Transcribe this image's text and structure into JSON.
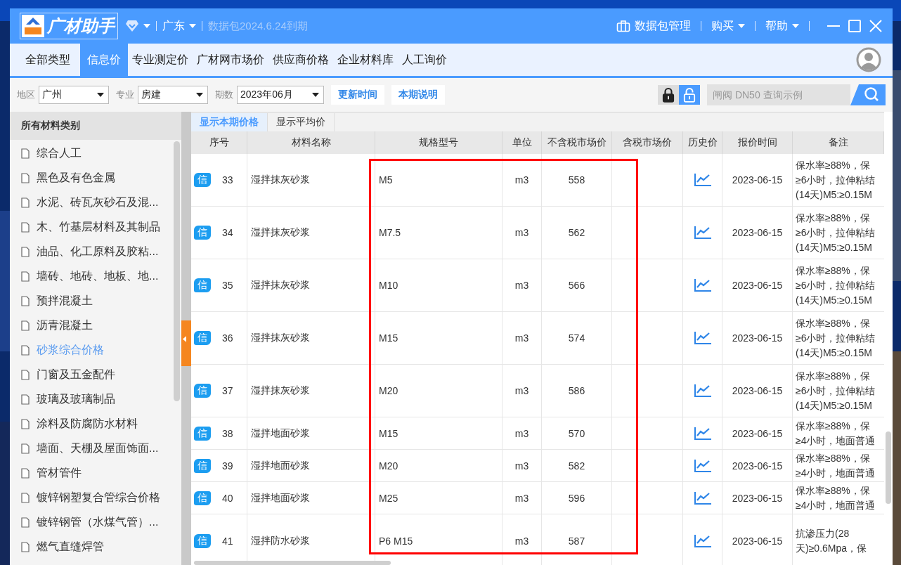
{
  "title_bar": {
    "logo_text": "广材助手",
    "region": "广东",
    "package_expiry": "数据包2024.6.24到期",
    "package_manager": "数据包管理",
    "menus": [
      "购买",
      "帮助"
    ]
  },
  "tabs": [
    {
      "label": "全部类型",
      "selected": false
    },
    {
      "label": "信息价",
      "selected": true
    },
    {
      "label": "专业测定价",
      "selected": false
    },
    {
      "label": "广材网市场价",
      "selected": false
    },
    {
      "label": "供应商价格",
      "selected": false
    },
    {
      "label": "企业材料库",
      "selected": false
    },
    {
      "label": "人工询价",
      "selected": false
    }
  ],
  "filters": [
    {
      "label": "地区",
      "value": "广州"
    },
    {
      "label": "专业",
      "value": "房建"
    },
    {
      "label": "期数",
      "value": "2023年06月"
    }
  ],
  "toolbar_buttons": [
    "更新时间",
    "本期说明"
  ],
  "locks": [
    {
      "locked": true
    },
    {
      "locked": false
    }
  ],
  "search": {
    "placeholder": "闸阀 DN50 查询示例"
  },
  "sidebar": {
    "title": "所有材料类别",
    "items": [
      {
        "label": "综合人工",
        "selected": false
      },
      {
        "label": "黑色及有色金属",
        "selected": false
      },
      {
        "label": "水泥、砖瓦灰砂石及混...",
        "selected": false
      },
      {
        "label": "木、竹基层材料及其制品",
        "selected": false
      },
      {
        "label": "油品、化工原料及胶粘...",
        "selected": false
      },
      {
        "label": "墙砖、地砖、地板、地...",
        "selected": false
      },
      {
        "label": "预拌混凝土",
        "selected": false
      },
      {
        "label": "沥青混凝土",
        "selected": false
      },
      {
        "label": "砂浆综合价格",
        "selected": true
      },
      {
        "label": "门窗及五金配件",
        "selected": false
      },
      {
        "label": "玻璃及玻璃制品",
        "selected": false
      },
      {
        "label": "涂料及防腐防水材料",
        "selected": false
      },
      {
        "label": "墙面、天棚及屋面饰面...",
        "selected": false
      },
      {
        "label": "管材管件",
        "selected": false
      },
      {
        "label": "镀锌钢塑复合管综合价格",
        "selected": false
      },
      {
        "label": "镀锌钢管（水煤气管）...",
        "selected": false
      },
      {
        "label": "燃气直缝焊管",
        "selected": false
      }
    ]
  },
  "view_tabs": [
    {
      "label": "显示本期价格",
      "selected": true
    },
    {
      "label": "显示平均价",
      "selected": false
    }
  ],
  "table": {
    "columns": [
      "序号",
      "材料名称",
      "规格型号",
      "单位",
      "不含税市场价",
      "含税市场价",
      "历史价",
      "报价时间",
      "备注"
    ],
    "rows": [
      {
        "badge": "信",
        "no": "33",
        "name": "湿拌抹灰砂浆",
        "spec": "M5",
        "unit": "m3",
        "price_ex_tax": "558",
        "date": "2023-06-15",
        "remark": [
          "保水率≥88%，保",
          "≥6小时，拉伸粘结",
          "(14天)M5:≥0.15M"
        ]
      },
      {
        "badge": "信",
        "no": "34",
        "name": "湿拌抹灰砂浆",
        "spec": "M7.5",
        "unit": "m3",
        "price_ex_tax": "562",
        "date": "2023-06-15",
        "remark": [
          "保水率≥88%，保",
          "≥6小时，拉伸粘结",
          "(14天)M5:≥0.15M"
        ]
      },
      {
        "badge": "信",
        "no": "35",
        "name": "湿拌抹灰砂浆",
        "spec": "M10",
        "unit": "m3",
        "price_ex_tax": "566",
        "date": "2023-06-15",
        "remark": [
          "保水率≥88%，保",
          "≥6小时，拉伸粘结",
          "(14天)M5:≥0.15M"
        ]
      },
      {
        "badge": "信",
        "no": "36",
        "name": "湿拌抹灰砂浆",
        "spec": "M15",
        "unit": "m3",
        "price_ex_tax": "574",
        "date": "2023-06-15",
        "remark": [
          "保水率≥88%，保",
          "≥6小时，拉伸粘结",
          "(14天)M5:≥0.15M"
        ]
      },
      {
        "badge": "信",
        "no": "37",
        "name": "湿拌抹灰砂浆",
        "spec": "M20",
        "unit": "m3",
        "price_ex_tax": "586",
        "date": "2023-06-15",
        "remark": [
          "保水率≥88%，保",
          "≥6小时，拉伸粘结",
          "(14天)M5:≥0.15M"
        ]
      },
      {
        "badge": "信",
        "no": "38",
        "name": "湿拌地面砂浆",
        "spec": "M15",
        "unit": "m3",
        "price_ex_tax": "570",
        "date": "2023-06-15",
        "remark": [
          "保水率≥88%，保",
          "≥4小时，地面普通"
        ]
      },
      {
        "badge": "信",
        "no": "39",
        "name": "湿拌地面砂浆",
        "spec": "M20",
        "unit": "m3",
        "price_ex_tax": "582",
        "date": "2023-06-15",
        "remark": [
          "保水率≥88%，保",
          "≥4小时，地面普通"
        ]
      },
      {
        "badge": "信",
        "no": "40",
        "name": "湿拌地面砂浆",
        "spec": "M25",
        "unit": "m3",
        "price_ex_tax": "596",
        "date": "2023-06-15",
        "remark": [
          "保水率≥88%，保",
          "≥4小时，地面普通"
        ]
      },
      {
        "badge": "信",
        "no": "41",
        "name": "湿拌防水砂浆",
        "spec": "P6 M15",
        "unit": "m3",
        "price_ex_tax": "587",
        "date": "2023-06-15",
        "remark": [
          "抗渗压力(28",
          "天)≥0.6Mpa，保"
        ]
      }
    ]
  },
  "highlight": {
    "kind": "rectangle"
  }
}
